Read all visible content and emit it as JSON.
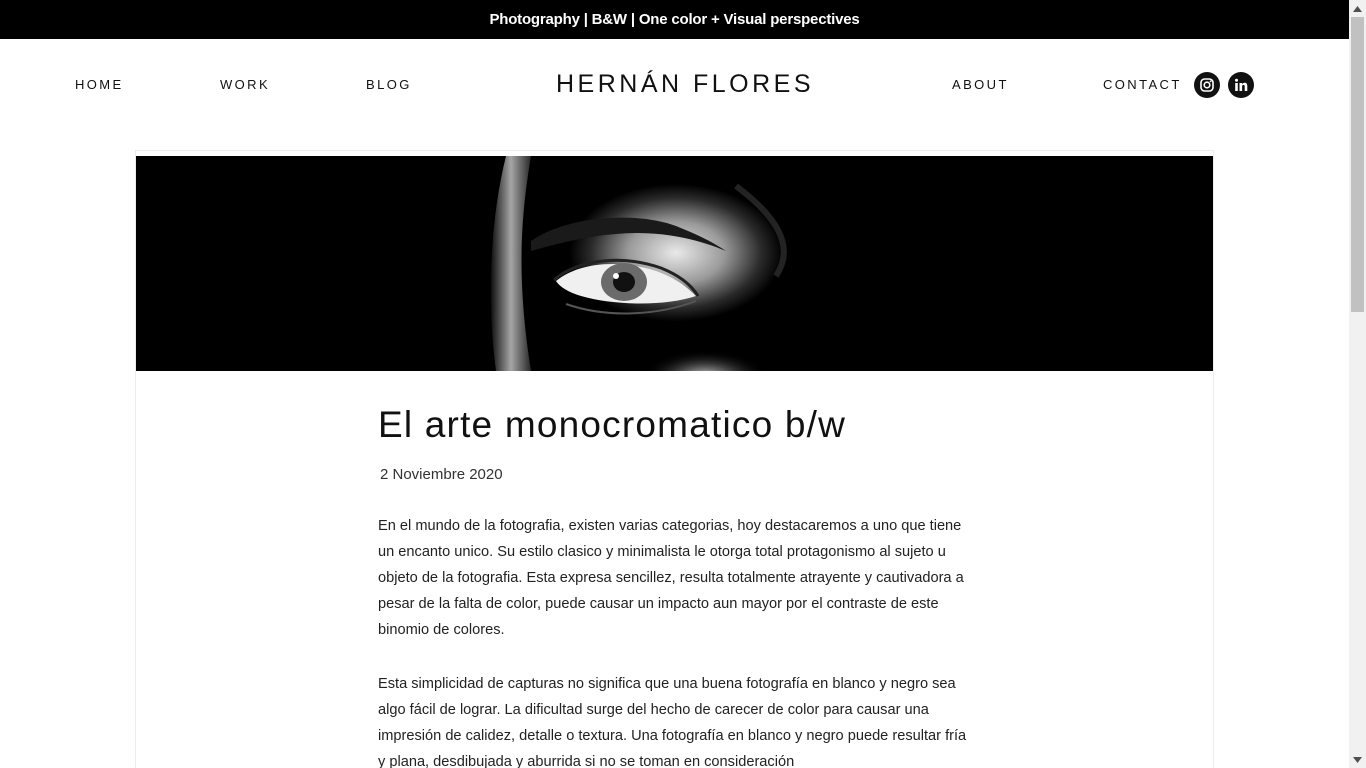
{
  "banner": {
    "text": "Photography | B&W | One color + Visual perspectives"
  },
  "nav": {
    "home": "HOME",
    "work": "WORK",
    "blog": "BLOG",
    "brand": "HERNÁN FLORES",
    "about": "ABOUT",
    "contact": "CONTACT",
    "social": [
      {
        "icon": "instagram-icon"
      },
      {
        "icon": "linkedin-icon"
      }
    ]
  },
  "post": {
    "hero_image": "black-and-white-eye-closeup",
    "title": "El arte monocromatico b/w",
    "date": "2 Noviembre 2020",
    "paragraphs": [
      "En el mundo de la fotografia, existen varias categorias, hoy destacaremos a uno que tiene un encanto unico. Su estilo clasico y minimalista le otorga total protagonismo al sujeto u objeto de la fotografia. Esta expresa sencillez, resulta totalmente atrayente y cautivadora a pesar de la falta de color, puede causar un impacto aun mayor por el contraste de este binomio de colores.",
      "Esta simplicidad de capturas no significa que una buena fotografía en blanco y negro sea algo fácil de lograr. La dificultad surge del hecho de carecer de color para causar una impresión de calidez, detalle o textura. Una fotografía en blanco y negro puede resultar fría y plana, desdibujada y aburrida si no se toman en consideración"
    ]
  },
  "colors": {
    "banner_bg": "#000000",
    "text": "#111111",
    "background": "#ffffff"
  }
}
